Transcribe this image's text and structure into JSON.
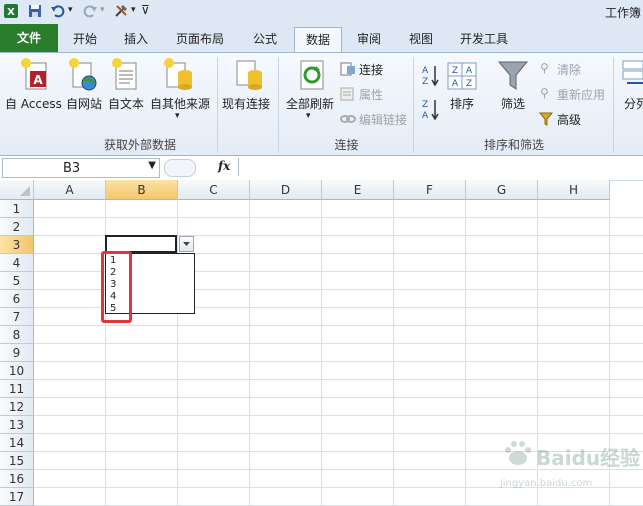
{
  "window": {
    "title": "工作簿"
  },
  "tabs": [
    {
      "label": "文件"
    },
    {
      "label": "开始"
    },
    {
      "label": "插入"
    },
    {
      "label": "页面布局"
    },
    {
      "label": "公式"
    },
    {
      "label": "数据"
    },
    {
      "label": "审阅"
    },
    {
      "label": "视图"
    },
    {
      "label": "开发工具"
    }
  ],
  "ribbon": {
    "groups": {
      "external": "获取外部数据",
      "connections": "连接",
      "sort_filter": "排序和筛选"
    },
    "buttons": {
      "access": "自 Access",
      "web": "自网站",
      "text": "自文本",
      "other": "自其他来源",
      "existing": "现有连接",
      "refresh_all": "全部刷新",
      "connections": "连接",
      "properties": "属性",
      "edit_links": "编辑链接",
      "sort": "排序",
      "filter": "筛选",
      "clear": "清除",
      "reapply": "重新应用",
      "advanced": "高级",
      "split": "分列"
    }
  },
  "formula_bar": {
    "name_box": "B3",
    "fx": "fx",
    "value": ""
  },
  "sheet": {
    "columns": [
      "A",
      "B",
      "C",
      "D",
      "E",
      "F",
      "G",
      "H"
    ],
    "rows": [
      "1",
      "2",
      "3",
      "4",
      "5",
      "6",
      "7",
      "8",
      "9",
      "10",
      "11",
      "12",
      "13",
      "14",
      "15",
      "16",
      "17"
    ],
    "selected_column": "B",
    "selected_row": "3"
  },
  "dropdown": {
    "options": [
      "1",
      "2",
      "3",
      "4",
      "5"
    ]
  },
  "watermark": {
    "brand": "Baidu经验",
    "url": "jingyan.baidu.com"
  },
  "colors": {
    "file_tab": "#2a7d2a",
    "highlight": "#e3343a",
    "selection": "#f3c66c"
  }
}
